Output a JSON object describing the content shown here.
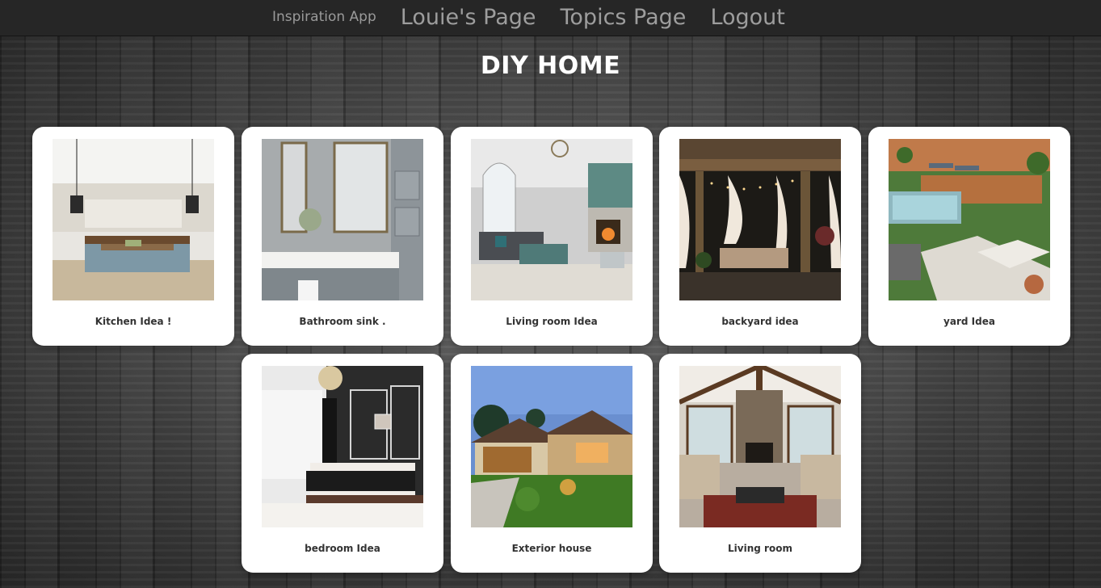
{
  "nav": {
    "brand": "Inspiration App",
    "links": [
      "Louie's Page",
      "Topics Page",
      "Logout"
    ]
  },
  "page": {
    "title": "DIY HOME"
  },
  "cards": [
    {
      "caption": "Kitchen Idea !",
      "image": "kitchen-photo"
    },
    {
      "caption": "Bathroom sink .",
      "image": "bathroom-photo"
    },
    {
      "caption": "Living room Idea",
      "image": "living-room-photo"
    },
    {
      "caption": "backyard idea",
      "image": "backyard-photo"
    },
    {
      "caption": "yard Idea",
      "image": "yard-photo"
    },
    {
      "caption": "bedroom Idea",
      "image": "bedroom-photo"
    },
    {
      "caption": "Exterior house",
      "image": "exterior-house-photo"
    },
    {
      "caption": "Living room",
      "image": "living-room-2-photo"
    }
  ]
}
